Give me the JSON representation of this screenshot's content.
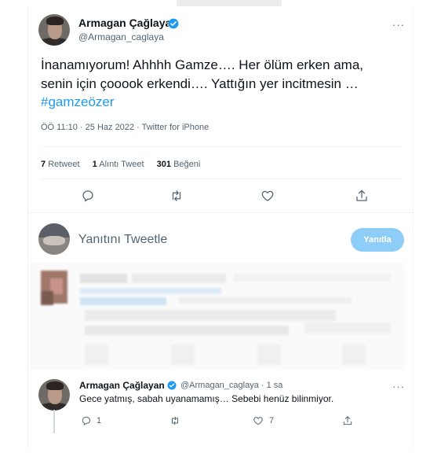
{
  "tweet": {
    "author_name": "Armagan Çağlayan",
    "author_handle": "@Armagan_caglaya",
    "text_line1": "İnanamıyorum! Ahhhh Gamze…. Her ölüm erken ama,",
    "text_line2": "senin için çooook erkendi…. Yattığın yer incitmesin …",
    "hashtag": "#gamzeözer",
    "timestamp": "ÖÖ 11:10 · 25 Haz 2022 · Twitter for iPhone",
    "more": "···",
    "stats": {
      "retweets_count": "7",
      "retweets_label": "Retweet",
      "quotes_count": "1",
      "quotes_label": "Alıntı Tweet",
      "likes_count": "301",
      "likes_label": "Beğeni"
    },
    "actions": [
      "reply-icon",
      "retweet-icon",
      "like-icon",
      "share-icon"
    ]
  },
  "composer": {
    "placeholder": "Yanıtını Tweetle",
    "button_label": "Yanıtla"
  },
  "reply": {
    "author_name": "Armagan Çağlayan",
    "handle_time": "@Armagan_caglaya · 1 sa",
    "text": "Gece yatmış, sabah uyanamamış… Sebebi henüz bilinmiyor.",
    "more": "···",
    "reply_count": "1",
    "like_count": "7"
  },
  "colors": {
    "accent": "#1d9bf0",
    "button_disabled": "#8ecdf8",
    "secondary_text": "#536471",
    "divider": "#eff3f4"
  }
}
